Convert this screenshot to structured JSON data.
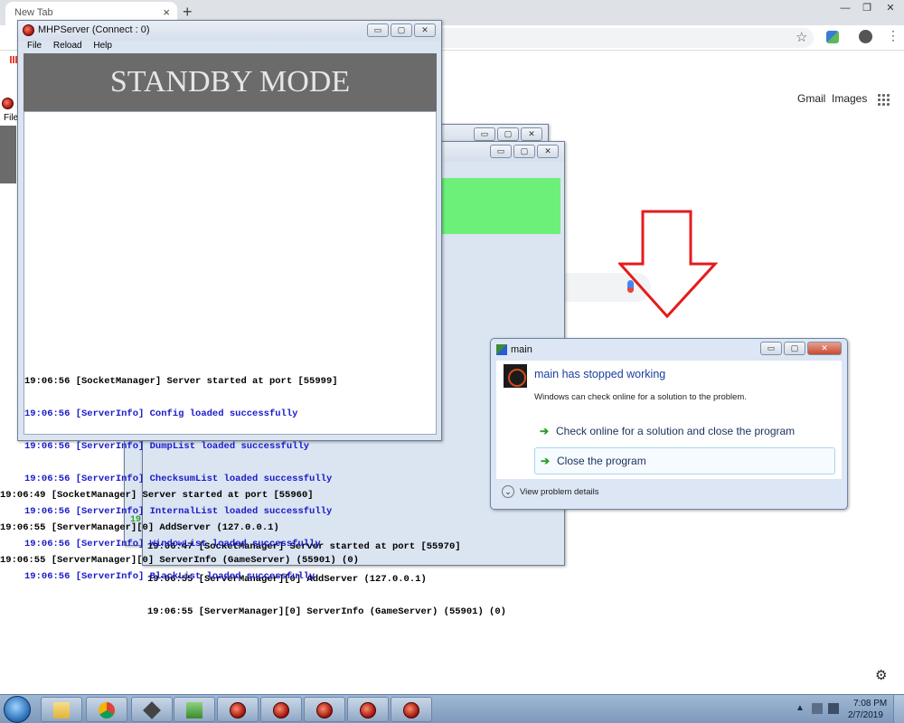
{
  "browser": {
    "tab_title": "New Tab",
    "tab_close": "×",
    "new_tab": "+",
    "window_controls": [
      "—",
      "❐",
      "✕"
    ],
    "star": "☆",
    "menu": "⋮",
    "gmail_label": "Gmail",
    "images_label": "Images",
    "settings_icon": "gear-icon"
  },
  "main_window": {
    "title": "MHPServer (Connect : 0)",
    "menu": [
      "File",
      "Reload",
      "Help"
    ],
    "banner": "STANDBY MODE",
    "buttons": [
      "▭",
      "▢",
      "✕"
    ],
    "log": [
      {
        "text": "19:06:56 [SocketManager] Server started at port [55999]",
        "color": "black"
      },
      {
        "text": "19:06:56 [ServerInfo] Config loaded successfully",
        "color": "blue"
      },
      {
        "text": "19:06:56 [ServerInfo] DumpList loaded successfully",
        "color": "blue"
      },
      {
        "text": "19:06:56 [ServerInfo] ChecksumList loaded successfully",
        "color": "blue"
      },
      {
        "text": "19:06:56 [ServerInfo] InternalList loaded successfully",
        "color": "blue"
      },
      {
        "text": "19:06:56 [ServerInfo] WindowList loaded successfully",
        "color": "blue"
      },
      {
        "text": "19:06:56 [ServerInfo] BlackList loaded successfully",
        "color": "blue"
      }
    ]
  },
  "left_window": {
    "menu_fragment": "File",
    "log": [
      "19:06:49 [SocketManager] Server started at port [55960]",
      "19:06:55 [ServerManager][0] AddServer (127.0.0.1)",
      "19:06:55 [ServerManager][0] ServerInfo (GameServer) (55901) (0)"
    ]
  },
  "back_window": {
    "green_fragment": "19",
    "log": [
      "19:06:47 [SocketManager] Server started at port [55970]",
      "19:06:55 [ServerManager][0] AddServer (127.0.0.1)",
      "19:06:55 [ServerManager][0] ServerInfo (GameServer) (55901) (0)"
    ]
  },
  "error_dialog": {
    "title": "main",
    "heading": "main has stopped working",
    "subtext": "Windows can check online for a solution to the problem.",
    "option_check": "Check online for a solution and close the program",
    "option_close": "Close the program",
    "details": "View problem details",
    "buttons": [
      "▭",
      "▢",
      "✕"
    ]
  },
  "taskbar": {
    "time": "7:08 PM",
    "date": "2/7/2019",
    "tray_arrow": "▲",
    "items": [
      "folder-icon",
      "chrome-icon",
      "box-icon",
      "check-icon",
      "mhp-icon",
      "mhp-icon",
      "mhp-icon",
      "mhp-icon",
      "mhp-icon"
    ]
  },
  "colors": {
    "accent_red_arrow": "#e51b1b",
    "green_panel": "#6df07a",
    "standby_bg": "#6b6b6b",
    "log_blue": "#1a1acc"
  }
}
